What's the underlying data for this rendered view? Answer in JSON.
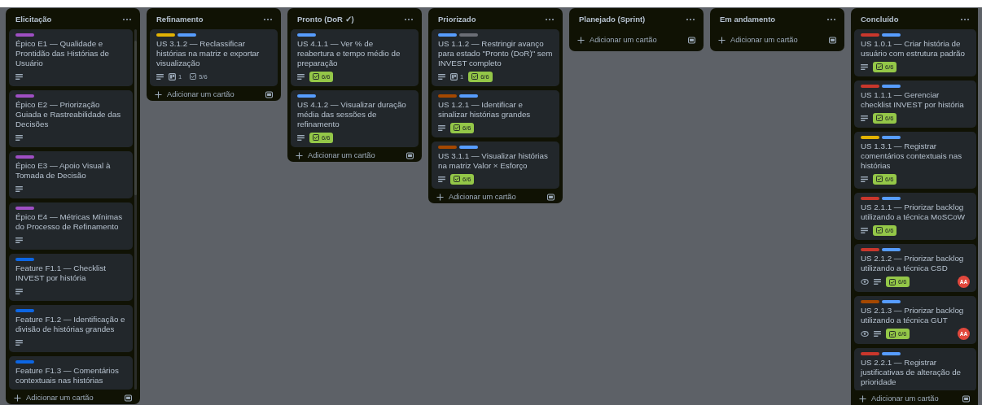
{
  "columns": [
    {
      "title": "Elicitação",
      "scrollbar": true,
      "add_label": "Adicionar um cartão",
      "cards": [
        {
          "labels": [
            {
              "color": "#9f4fc4"
            }
          ],
          "title": "Épico E1 — Qualidade e Prontidão das Histórias de Usuário",
          "description": true
        },
        {
          "labels": [
            {
              "color": "#9f4fc4"
            }
          ],
          "title": "Épico E2 — Priorização Guiada e Rastreabilidade das Decisões",
          "description": true
        },
        {
          "labels": [
            {
              "color": "#9f4fc4"
            }
          ],
          "title": "Épico E3 — Apoio Visual à Tomada de Decisão",
          "description": true
        },
        {
          "labels": [
            {
              "color": "#9f4fc4"
            }
          ],
          "title": "Épico E4 — Métricas Mínimas do Processo de Refinamento",
          "description": true
        },
        {
          "labels": [
            {
              "color": "#0c66e4"
            }
          ],
          "title": "Feature F1.1 — Checklist INVEST por história",
          "description": true
        },
        {
          "labels": [
            {
              "color": "#0c66e4"
            }
          ],
          "title": "Feature F1.2 — Identificação e divisão de histórias grandes",
          "description": true
        },
        {
          "labels": [
            {
              "color": "#0c66e4"
            }
          ],
          "title": "Feature F1.3 — Comentários contextuais nas histórias",
          "description": false
        }
      ]
    },
    {
      "title": "Refinamento",
      "scrollbar": false,
      "add_label": "Adicionar um cartão",
      "cards": [
        {
          "labels": [
            {
              "color": "#e2b203"
            },
            {
              "color": "#579dff"
            }
          ],
          "title": "US 3.1.2 — Reclassificar histórias na matriz e exportar visualização",
          "description": true,
          "attachments": "1",
          "checklist": {
            "text": "5/6",
            "complete": false
          }
        }
      ]
    },
    {
      "title": "Pronto (DoR ✓)",
      "scrollbar": false,
      "add_label": "Adicionar um cartão",
      "cards": [
        {
          "labels": [
            {
              "color": "#579dff"
            }
          ],
          "title": "US 4.1.1 — Ver % de reabertura e tempo médio de preparação",
          "description": true,
          "checklist": {
            "text": "6/6",
            "complete": true
          }
        },
        {
          "labels": [
            {
              "color": "#579dff"
            }
          ],
          "title": "US 4.1.2 — Visualizar duração média das sessões de refinamento",
          "description": true,
          "checklist": {
            "text": "6/6",
            "complete": true
          }
        }
      ]
    },
    {
      "title": "Priorizado",
      "scrollbar": false,
      "add_label": "Adicionar um cartão",
      "cards": [
        {
          "labels": [
            {
              "color": "#579dff"
            },
            {
              "color": "#6b6e76"
            }
          ],
          "title": "US 1.1.2 — Restringir avanço para estado \"Pronto (DoR)\" sem INVEST completo",
          "description": true,
          "attachments": "1",
          "checklist": {
            "text": "6/6",
            "complete": true
          }
        },
        {
          "labels": [
            {
              "color": "#a54800"
            },
            {
              "color": "#579dff"
            }
          ],
          "title": "US 1.2.1 — Identificar e sinalizar histórias grandes",
          "description": true,
          "checklist": {
            "text": "6/6",
            "complete": true
          }
        },
        {
          "labels": [
            {
              "color": "#a54800"
            },
            {
              "color": "#579dff"
            }
          ],
          "title": "US 3.1.1 — Visualizar histórias na matriz Valor × Esforço",
          "description": true,
          "checklist": {
            "text": "6/6",
            "complete": true
          }
        }
      ]
    },
    {
      "title": "Planejado (Sprint)",
      "scrollbar": false,
      "add_label": "Adicionar um cartão"
    },
    {
      "title": "Em andamento",
      "scrollbar": false,
      "add_label": "Adicionar um cartão"
    },
    {
      "title": "Concluído",
      "scrollbar": false,
      "add_label": "Adicionar um cartão",
      "cards": [
        {
          "labels": [
            {
              "color": "#c9372c"
            },
            {
              "color": "#579dff"
            }
          ],
          "title": "US 1.0.1 — Criar história de usuário com estrutura padrão",
          "description": true,
          "checklist": {
            "text": "6/6",
            "complete": true
          }
        },
        {
          "labels": [
            {
              "color": "#c9372c"
            },
            {
              "color": "#579dff"
            }
          ],
          "title": "US 1.1.1 — Gerenciar checklist INVEST por história",
          "description": true,
          "checklist": {
            "text": "6/6",
            "complete": true
          }
        },
        {
          "labels": [
            {
              "color": "#e2b203"
            },
            {
              "color": "#579dff"
            }
          ],
          "title": "US 1.3.1 — Registrar comentários contextuais nas histórias",
          "description": true,
          "checklist": {
            "text": "6/6",
            "complete": true
          }
        },
        {
          "labels": [
            {
              "color": "#c9372c"
            },
            {
              "color": "#579dff"
            }
          ],
          "title": "US 2.1.1 — Priorizar backlog utilizando a técnica MoSCoW",
          "description": true,
          "checklist": {
            "text": "6/6",
            "complete": true
          }
        },
        {
          "labels": [
            {
              "color": "#c9372c"
            },
            {
              "color": "#579dff"
            }
          ],
          "title": "US 2.1.2 — Priorizar backlog utilizando a técnica CSD",
          "watching": true,
          "description": true,
          "checklist": {
            "text": "6/6",
            "complete": true
          },
          "members": [
            "AA"
          ]
        },
        {
          "labels": [
            {
              "color": "#a54800"
            },
            {
              "color": "#579dff"
            }
          ],
          "title": "US 2.1.3 — Priorizar backlog utilizando a técnica GUT",
          "watching": true,
          "description": true,
          "checklist": {
            "text": "6/6",
            "complete": true
          },
          "members": [
            "AA"
          ]
        },
        {
          "labels": [
            {
              "color": "#c9372c"
            },
            {
              "color": "#579dff"
            }
          ],
          "title": "US 2.2.1 — Registrar justificativas de alteração de prioridade",
          "description": false
        }
      ]
    }
  ]
}
